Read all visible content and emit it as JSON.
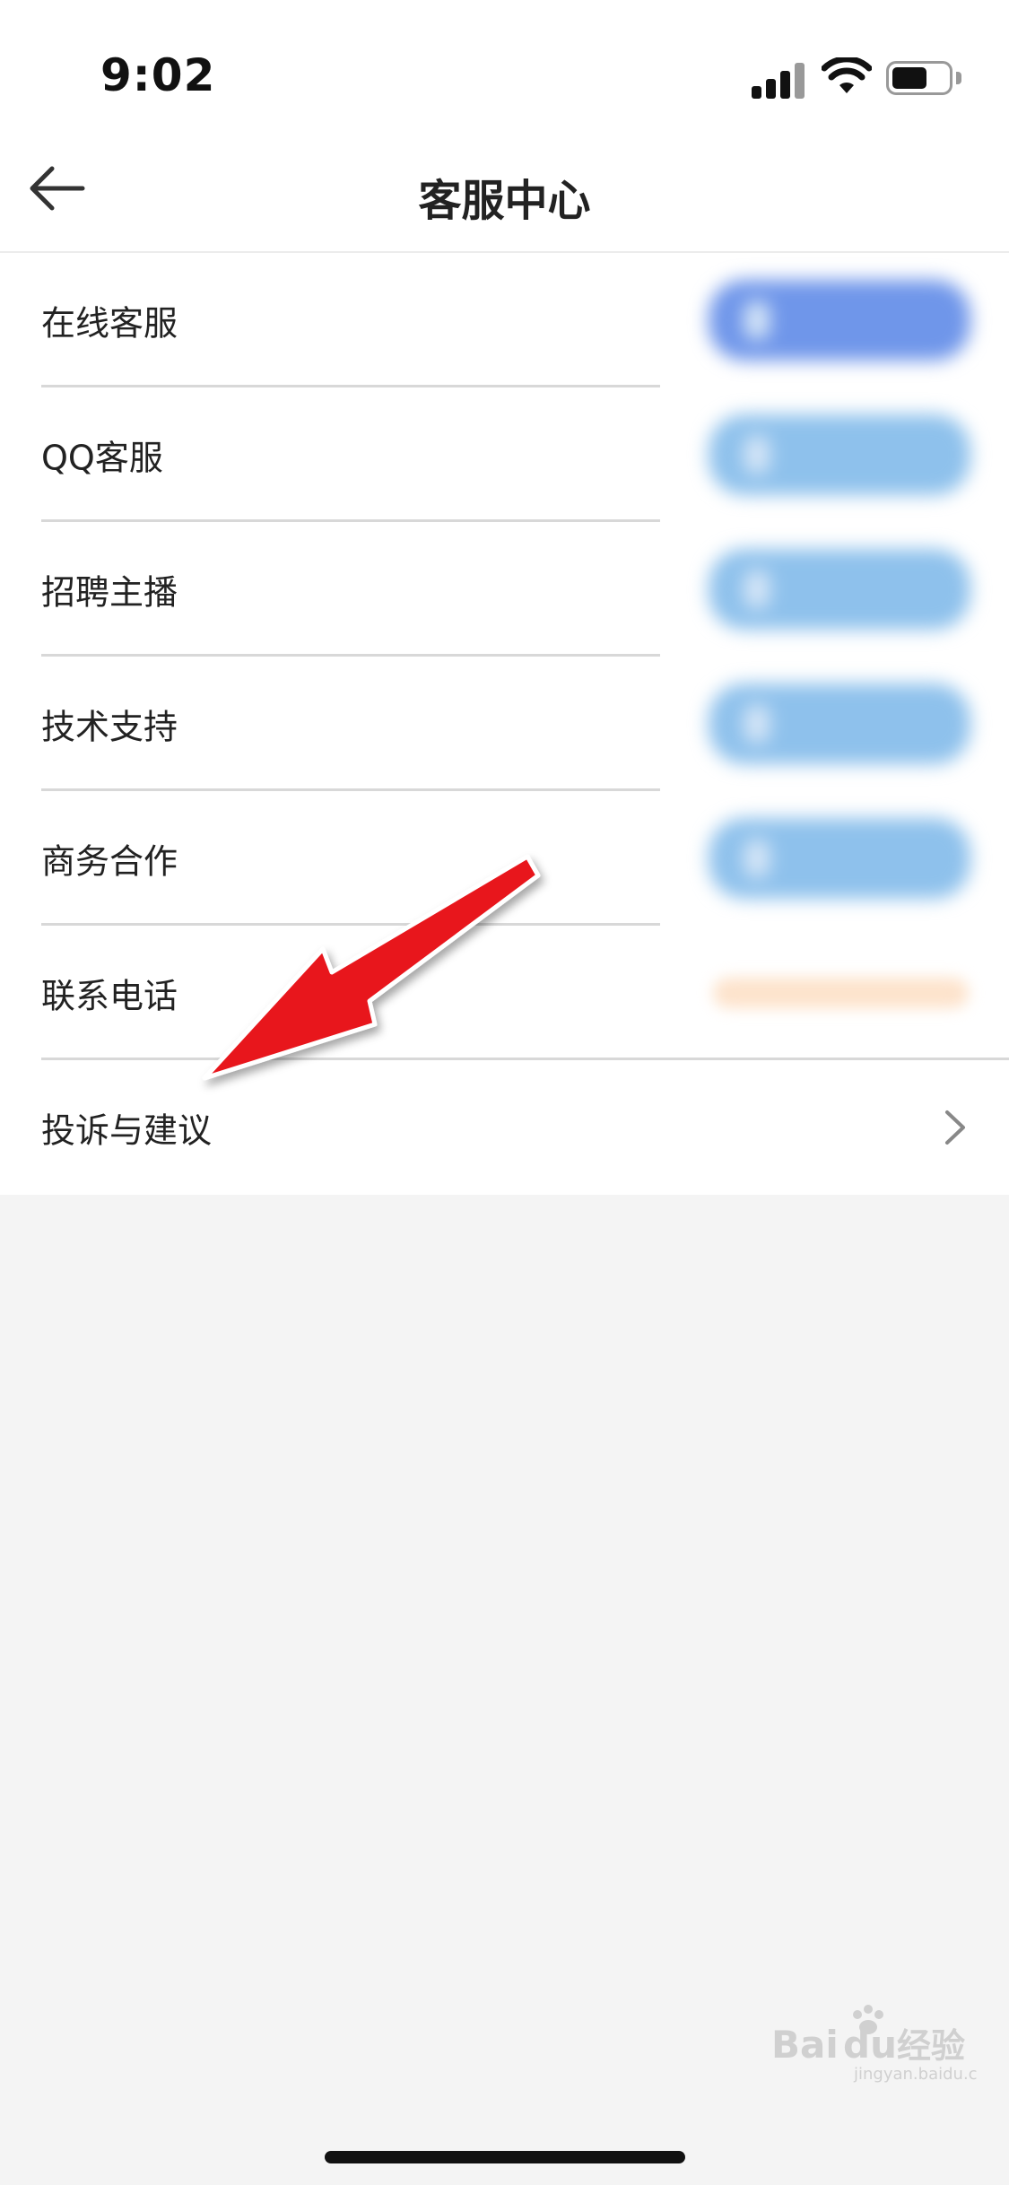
{
  "status_bar": {
    "time": "9:02",
    "icons": [
      "signal-icon",
      "wifi-icon",
      "battery-icon"
    ]
  },
  "header": {
    "title": "客服中心",
    "back_icon": "arrow-left-icon"
  },
  "menu": {
    "items": [
      {
        "label": "在线客服"
      },
      {
        "label": "QQ客服"
      },
      {
        "label": "招聘主播"
      },
      {
        "label": "技术支持"
      },
      {
        "label": "商务合作"
      },
      {
        "label": "联系电话"
      },
      {
        "label": "投诉与建议"
      }
    ]
  },
  "colors": {
    "action_primary": "#6f96ea",
    "action_secondary": "#8ec1ec",
    "phone_value": "#fde3cc",
    "annotation_arrow": "#e8141c"
  },
  "watermark": {
    "brand": "Baidu经验",
    "url": "jingyan.baidu.com"
  }
}
